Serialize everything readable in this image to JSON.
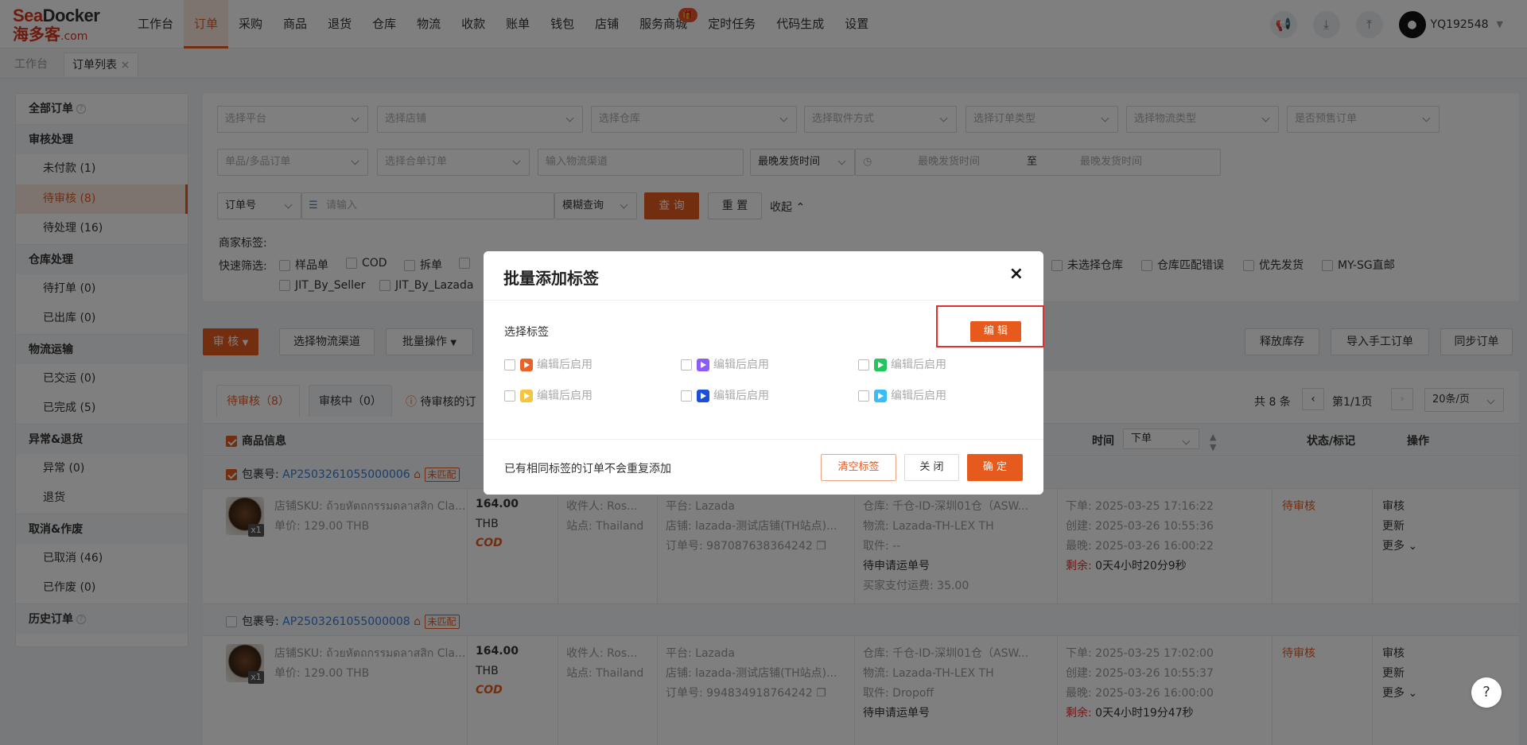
{
  "logo": {
    "brand_red": "Sea",
    "brand_dark": "Docker",
    "cn": "海多客",
    "dotcom": ".com"
  },
  "nav": {
    "items": [
      "工作台",
      "订单",
      "采购",
      "商品",
      "退货",
      "仓库",
      "物流",
      "收款",
      "账单",
      "钱包",
      "店铺",
      "服务商城",
      "定时任务",
      "代码生成",
      "设置"
    ],
    "active": "订单",
    "username": "YQ192548"
  },
  "tabs": {
    "workbench": "工作台",
    "orderlist": "订单列表",
    "close": "×"
  },
  "sidebar": {
    "all_orders": "全部订单",
    "g_audit": "审核处理",
    "unpaid": "未付款 (1)",
    "pending_audit": "待审核 (8)",
    "pending_process": "待处理 (16)",
    "g_warehouse": "仓库处理",
    "pending_print": "待打单 (0)",
    "shipped_out": "已出库 (0)",
    "g_logistics": "物流运输",
    "delivered": "已交运 (0)",
    "completed": "已完成 (5)",
    "g_exception": "异常&退货",
    "exception": "异常 (0)",
    "returns": "退货",
    "g_cancel": "取消&作废",
    "cancelled": "已取消 (46)",
    "voided": "已作废 (0)",
    "history": "历史订单"
  },
  "filters": {
    "platform": "选择平台",
    "store": "选择店铺",
    "warehouse": "选择仓库",
    "pickup": "选择取件方式",
    "order_type": "选择订单类型",
    "logistics_type": "选择物流类型",
    "presale": "是否预售订单",
    "single_multi": "单品/多品订单",
    "merge": "选择合单订单",
    "logistics_channel": "输入物流渠道",
    "latest_ship": "最晚发货时间",
    "time_start": "最晚发货时间",
    "time_to": "至",
    "time_end": "最晚发货时间",
    "order_no": "订单号",
    "input": "请输入",
    "fuzzy": "模糊查询",
    "query": "查 询",
    "reset": "重 置",
    "collapse": "收起",
    "merchant_tag": "商家标签:",
    "quick": "快速筛选:",
    "q1": "样品单",
    "q2": "COD",
    "q3": "拆单",
    "q_nowh": "未选择仓库",
    "q_whmis": "仓库匹配错误",
    "q_priority": "优先发货",
    "q_mysg": "MY-SG直邮",
    "q_jit1": "JIT_By_Seller",
    "q_jit2": "JIT_By_Lazada"
  },
  "actions": {
    "audit": "审 核",
    "select_channel": "选择物流渠道",
    "batch": "批量操作",
    "release": "释放库存",
    "import": "导入手工订单",
    "sync": "同步订单"
  },
  "list": {
    "tab1": "待审核（8）",
    "tab2": "审核中（0）",
    "tab3": "待审核的订",
    "summary": "共 8 条",
    "page": "第1/1页",
    "per_page": "20条/页",
    "h_product": "商品信息",
    "h_time": "时间",
    "h_time_sel": "下单",
    "h_status": "状态/标记",
    "h_op": "操作",
    "pkg_label": "包裹号:",
    "unmatched": "未匹配",
    "orders": [
      {
        "pkg": "AP2503261055000006",
        "sku": "店铺SKU: ถ้วยหัตถกรรมดลาสสิก Cla...",
        "price": "单价: 129.00 THB",
        "qty": "x1",
        "amount": "164.00",
        "cur": "THB",
        "cod": "COD",
        "receiver": "收件人: Ros...",
        "site": "站点: Thailand",
        "platform": "平台: Lazada",
        "store": "店铺: lazada-测试店铺(TH站点)...",
        "orderno": "订单号: 987087638364242",
        "wh": "仓库: 千仓-ID-深圳01仓（ASW...",
        "logi": "物流: Lazada-TH-LEX TH",
        "pick": "取件: --",
        "trk": "待申请运单号",
        "fee": "买家支付运费: 35.00",
        "t1": "下单: 2025-03-25 17:16:22",
        "t2": "创建: 2025-03-26 10:55:36",
        "t3": "最晚: 2025-03-26 16:00:22",
        "rem_lbl": "剩余:",
        "rem": "0天4小时20分9秒",
        "status": "待审核",
        "op1": "审核",
        "op2": "更新",
        "op3": "更多"
      },
      {
        "pkg": "AP2503261055000008",
        "sku": "店铺SKU: ถ้วยหัตถกรรมดลาสสิก Cla...",
        "price": "单价: 129.00 THB",
        "qty": "x1",
        "amount": "164.00",
        "cur": "THB",
        "cod": "COD",
        "receiver": "收件人: Ros...",
        "site": "站点: Thailand",
        "platform": "平台: Lazada",
        "store": "店铺: lazada-测试店铺(TH站点)...",
        "orderno": "订单号: 994834918764242",
        "wh": "仓库: 千仓-ID-深圳01仓（ASW...",
        "logi": "物流: Lazada-TH-LEX TH",
        "pick": "取件: Dropoff",
        "trk": "待申请运单号",
        "fee": "",
        "t1": "下单: 2025-03-25 17:02:00",
        "t2": "创建: 2025-03-26 10:55:37",
        "t3": "最晚: 2025-03-26 16:00:00",
        "rem_lbl": "剩余:",
        "rem": "0天4小时19分47秒",
        "status": "待审核",
        "op1": "审核",
        "op2": "更新",
        "op3": "更多"
      }
    ]
  },
  "modal": {
    "title": "批量添加标签",
    "close": "×",
    "select_tag": "选择标签",
    "edit": "编 辑",
    "tags": [
      {
        "label": "编辑后启用",
        "color": "#e8622a"
      },
      {
        "label": "编辑后启用",
        "color": "#8b5cf6"
      },
      {
        "label": "编辑后启用",
        "color": "#22c55e"
      },
      {
        "label": "编辑后启用",
        "color": "#f5c542"
      },
      {
        "label": "编辑后启用",
        "color": "#1d4ed8"
      },
      {
        "label": "编辑后启用",
        "color": "#38bdf8"
      }
    ],
    "note": "已有相同标签的订单不会重复添加",
    "clear": "清空标签",
    "cancel": "关 闭",
    "confirm": "确 定"
  },
  "help": "?",
  "colors": {
    "accent": "#e65a1e"
  }
}
